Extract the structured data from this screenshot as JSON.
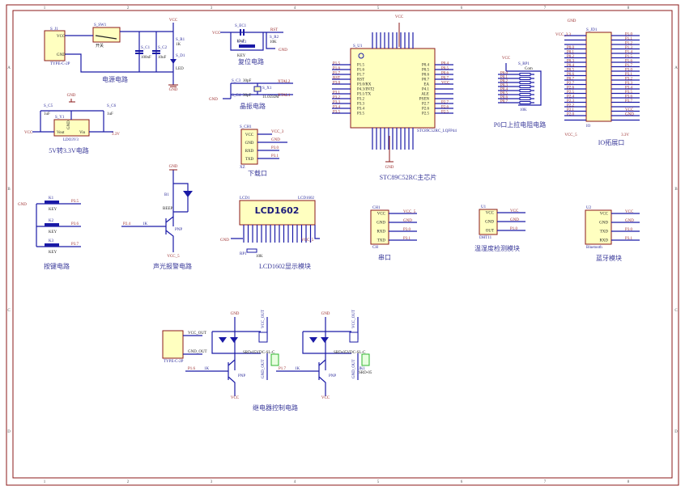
{
  "sections": {
    "power": "电源电路",
    "conv": "5V转3.3V电路",
    "reset": "复位电路",
    "crystal": "晶振电路",
    "download": "下载口",
    "mcu": "STC89C52RC主芯片",
    "pullup": "P0口上拉电阻电路",
    "io": "IO拓展口",
    "keys": "按键电路",
    "buzzer": "声光报警电路",
    "lcd": "LCD1602显示模块",
    "serial": "串口",
    "dht": "温湿度检测模块",
    "bt": "蓝牙模块",
    "relay": "继电器控制电路"
  },
  "power": {
    "conn": "S_J1",
    "conn_type": "TYPE-C-2P",
    "vcc": "VCC",
    "gnd": "GND",
    "sw": "S_SW1",
    "sw_label": "开关",
    "c1": "S_C1",
    "c1v": "100nF",
    "c2": "S_C2",
    "c2v": "10uF",
    "r1": "S_R1",
    "r1v": "1K",
    "d1": "S_D1",
    "d1v": "LED",
    "net_vcc": "VCC",
    "net_gnd": "GND"
  },
  "conv": {
    "ref": "S_Y1",
    "part": "LDO3V3",
    "vout": "Vout",
    "vin": "Vin",
    "gnd": "GND",
    "c5": "S_C5",
    "c5v": "1uF",
    "c6": "S_C6",
    "c6v": "1uF",
    "net_vcc": "VCC",
    "net_33": "3.3V",
    "net_gnd": "GND"
  },
  "reset": {
    "ec": "S_EC1",
    "ecv": "10uF",
    "key": "S_K1",
    "keyv": "KEY",
    "r2": "S_R2",
    "r2v": "10K",
    "rst": "RST",
    "vcc": "VCC",
    "gnd": "GND"
  },
  "crystal": {
    "c3": "S_C3",
    "c3v": "30pF",
    "c4": "S_C4",
    "c4v": "30pF",
    "x": "S_X1",
    "xv": "11.0592M",
    "xtal2": "XTAL2",
    "xtal1": "XTAL1",
    "gnd": "GND"
  },
  "download": {
    "ref": "S_CH1",
    "part": "XZ",
    "pins": [
      "VCC",
      "GND",
      "RXD",
      "TXD"
    ],
    "nets": [
      "VCC_3",
      "GND",
      "P3.0",
      "P3.1"
    ]
  },
  "mcu": {
    "ref": "S_U1",
    "part": "STC89C52RC_LQFP44",
    "vcc": "VCC",
    "gnd": "GND",
    "left": [
      "P1.5",
      "P1.6",
      "P1.7",
      "RST",
      "P3.0/RX",
      "P4.3/INT2",
      "P3.1/TX",
      "P3.2",
      "P3.3",
      "P3.4",
      "P3.5"
    ],
    "right": [
      "P0.4",
      "P0.5",
      "P0.6",
      "P0.7",
      "EA",
      "P4.1",
      "ALE",
      "PSEN",
      "P2.7",
      "P2.6",
      "P2.5"
    ],
    "left_nets": [
      "P1.5",
      "P1.6",
      "P1.7",
      "RST",
      "P3.0",
      "",
      "P3.1",
      "P3.2",
      "P3.3",
      "P3.4",
      "P3.5"
    ],
    "right_nets": [
      "P0.4",
      "P0.5",
      "P0.6",
      "P0.7",
      "VCC",
      "",
      "",
      "",
      "P2.7",
      "P2.6",
      "P2.5"
    ]
  },
  "pullup": {
    "ref": "S_RP1",
    "com": "Com",
    "part": "10K",
    "vcc": "VCC",
    "nets": [
      "P0.0",
      "P0.1",
      "P0.2",
      "P0.3",
      "P0.4",
      "P0.5",
      "P0.6",
      "P0.7"
    ]
  },
  "io": {
    "ref": "S_JD1",
    "part": "IO",
    "gnd": "GND",
    "vcc33": "VCC_3.3",
    "vcc5": "VCC_5",
    "v33": "3.3V",
    "vcc": "VCC",
    "left_nets": [
      "",
      "",
      "",
      "P0.0",
      "P0.1",
      "P0.2",
      "P0.3",
      "P0.4",
      "P0.5",
      "P0.6",
      "P0.7",
      "P2.7",
      "P2.6",
      "P2.5",
      "P2.4",
      "P2.3",
      "P2.2",
      "P2.1",
      "P2.0",
      ""
    ],
    "right_nets": [
      "P1.0",
      "P1.1",
      "P1.2",
      "P1.3",
      "P1.4",
      "P1.5",
      "P1.6",
      "P1.7",
      "P3.0",
      "P3.1",
      "P3.2",
      "P3.3",
      "P3.4",
      "P3.5",
      "P3.6",
      "P3.7",
      "",
      "VCC",
      "GND",
      ""
    ]
  },
  "keys": {
    "gnd": "GND",
    "items": [
      {
        "ref": "K1",
        "part": "KEY",
        "net": "P3.5"
      },
      {
        "ref": "K2",
        "part": "KEY",
        "net": "P3.6"
      },
      {
        "ref": "K3",
        "part": "KEY",
        "net": "P3.7"
      }
    ]
  },
  "buzzer": {
    "gnd": "GND",
    "b": "B1",
    "bv": "BEEP",
    "r": "1K",
    "net": "P2.4",
    "q": "PNP",
    "vcc": "VCC_5"
  },
  "lcd": {
    "ref": "LCD1",
    "part": "LCD1602",
    "display": "LCD1602",
    "rp": "RP1",
    "rpv": "10K",
    "gnd": "GND",
    "vcc": "VCC_5"
  },
  "serial": {
    "ref": "CH1",
    "part": "CH",
    "pins": [
      "VCC",
      "GND",
      "RXD",
      "TXD"
    ],
    "nets": [
      "VCC_5",
      "GND",
      "P3.0",
      "P3.1"
    ]
  },
  "dht": {
    "ref": "U1",
    "part": "DHT11",
    "pins": [
      "VCC",
      "GND",
      "OUT"
    ],
    "nets": [
      "VCC",
      "GND",
      "P1.0"
    ]
  },
  "bt": {
    "ref": "U2",
    "part": "Bluetooth",
    "pins": [
      "VCC",
      "GND",
      "TXD",
      "RXD"
    ],
    "nets": [
      "VCC",
      "GND",
      "P3.0",
      "P3.1"
    ]
  },
  "relay": {
    "conn": "TYPE-C-2P",
    "vcc_out": "VCC_OUT",
    "gnd_out": "GND_OUT",
    "gnd": "GND",
    "vcc": "VCC",
    "r": "1K",
    "q": "PNP",
    "relay": "SRD-05VDC-SL-C",
    "ch1_net": "P1.6",
    "ch2_net": "P1.7",
    "jk": "JK1",
    "jkv": "SRD-05"
  },
  "frame": {
    "cols": [
      "1",
      "2",
      "3",
      "4",
      "5",
      "6",
      "7",
      "8"
    ],
    "rows": [
      "A",
      "B",
      "C",
      "D"
    ]
  },
  "colors": {
    "wire": "#1a1aa6",
    "power": "#8b1a1a",
    "part_fill": "#ffffc0",
    "relay_terminal": "#2fb52f"
  }
}
